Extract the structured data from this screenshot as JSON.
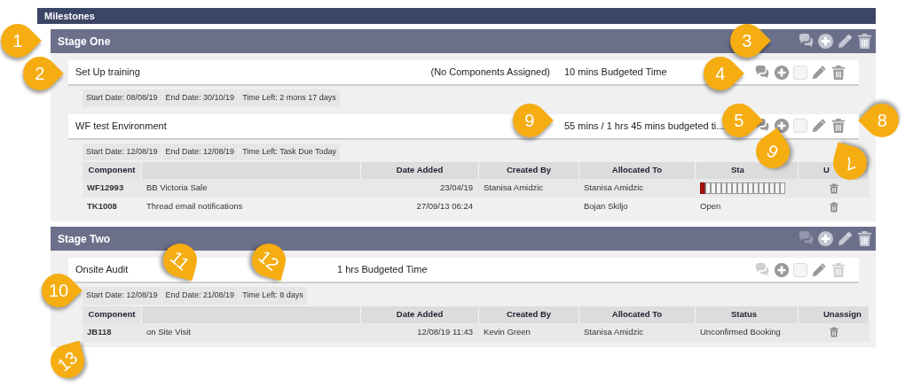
{
  "panel": {
    "title": "Milestones"
  },
  "stages": [
    {
      "title": "Stage One",
      "icons": [
        {
          "kind": "comment",
          "disabled": false
        },
        {
          "kind": "add",
          "disabled": false
        },
        {
          "kind": "edit",
          "disabled": false
        },
        {
          "kind": "delete",
          "disabled": false
        }
      ],
      "tasks": [
        {
          "name": "Set Up training",
          "info": [
            {
              "kind": "note",
              "text": "(No Components Assigned)"
            },
            {
              "kind": "budget",
              "text": "10 mins Budgeted Time"
            }
          ],
          "icons": [
            {
              "kind": "comment",
              "disabled": false
            },
            {
              "kind": "add",
              "disabled": false
            },
            {
              "kind": "checkbox",
              "checked": false
            },
            {
              "kind": "edit",
              "disabled": false
            },
            {
              "kind": "delete",
              "disabled": false
            }
          ],
          "dates": [
            "Start Date: 08/08/19",
            "End Date: 30/10/19",
            "Time Left: 2 mons 17 days"
          ]
        },
        {
          "name": "WF test Environment",
          "info": [
            {
              "kind": "used",
              "text": "55 mins / 1 hrs 45 mins budgeted ti..."
            }
          ],
          "icons": [
            {
              "kind": "comment",
              "disabled": false
            },
            {
              "kind": "add",
              "disabled": false
            },
            {
              "kind": "checkbox",
              "checked": false
            },
            {
              "kind": "edit",
              "disabled": false
            },
            {
              "kind": "delete",
              "disabled": false
            }
          ],
          "dates": [
            "Start Date: 12/08/19",
            "End Date: 12/08/19",
            "Time Left: Task Due Today"
          ],
          "table": {
            "columns": [
              "Component",
              null,
              "Date Added",
              "Created By",
              "Allocated To",
              "Sta",
              "U"
            ],
            "rows": [
              {
                "component": "WF12993",
                "description": "BB Victoria Sale",
                "date_added": "23/04/19",
                "created_by": "Stanisa Amidzic",
                "allocated_to": "Stanisa Amidzic",
                "status": {
                  "kind": "progress",
                  "level": 0.0625
                }
              },
              {
                "component": "TK1008",
                "description": "Thread email notifications",
                "date_added": "27/09/13 06:24",
                "allocated_to": "Bojan Skiljo",
                "status": {
                  "kind": "text",
                  "text": "Open"
                }
              }
            ]
          }
        }
      ]
    },
    {
      "title": "Stage Two",
      "icons": [
        {
          "kind": "comment",
          "disabled": true
        },
        {
          "kind": "add",
          "disabled": false
        },
        {
          "kind": "edit",
          "disabled": false
        },
        {
          "kind": "delete",
          "disabled": false
        }
      ],
      "tasks": [
        {
          "name": "Onsite Audit",
          "info": [
            {
              "kind": "budget",
              "text": "1 hrs Budgeted Time"
            }
          ],
          "icons": [
            {
              "kind": "comment",
              "disabled": true
            },
            {
              "kind": "add",
              "disabled": false
            },
            {
              "kind": "checkbox",
              "checked": false
            },
            {
              "kind": "edit",
              "disabled": false
            },
            {
              "kind": "delete",
              "disabled": true
            }
          ],
          "dates": [
            "Start Date: 12/08/19",
            "End Date: 21/08/19",
            "Time Left: 8 days"
          ],
          "table": {
            "columns": [
              "Component",
              null,
              "Date Added",
              "Created By",
              "Allocated To",
              "Status",
              "Unassign"
            ],
            "rows": [
              {
                "component": "JB118",
                "description": "on Site Visit",
                "date_added": "12/08/19 11:43",
                "created_by": "Kevin Green",
                "allocated_to": "Stanisa Amidzic",
                "status": {
                  "kind": "text",
                  "text": "Unconfirmed Booking"
                }
              }
            ]
          }
        }
      ]
    }
  ],
  "callouts": [
    {
      "text": "1"
    },
    {
      "text": "2"
    },
    {
      "text": "3"
    },
    {
      "text": "4"
    },
    {
      "text": "9"
    },
    {
      "text": "5"
    },
    {
      "text": "8"
    },
    {
      "text": "6"
    },
    {
      "text": "7"
    },
    {
      "text": "10"
    },
    {
      "text": "11"
    },
    {
      "text": "12"
    },
    {
      "text": "13"
    }
  ]
}
